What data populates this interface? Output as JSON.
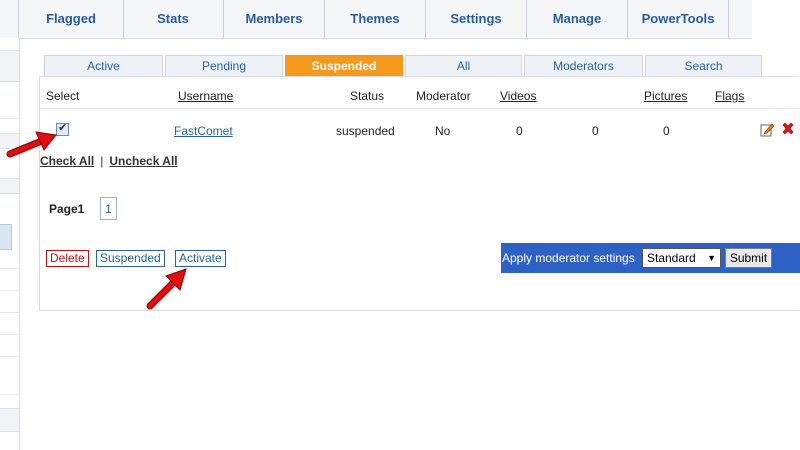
{
  "topnav": {
    "items": [
      "Flagged",
      "Stats",
      "Members",
      "Themes",
      "Settings",
      "Manage",
      "PowerTools"
    ]
  },
  "tabs": [
    {
      "label": "Active",
      "active": false
    },
    {
      "label": "Pending",
      "active": false
    },
    {
      "label": "Suspended",
      "active": true
    },
    {
      "label": "All",
      "active": false
    },
    {
      "label": "Moderators",
      "active": false
    },
    {
      "label": "Search",
      "active": false
    }
  ],
  "table": {
    "headers": {
      "select": "Select",
      "username": "Username",
      "status": "Status",
      "moderator": "Moderator",
      "videos": "Videos",
      "pictures": "Pictures",
      "flags": "Flags"
    },
    "rows": [
      {
        "checked": true,
        "username": "FastComet",
        "status": "suspended",
        "moderator": "No",
        "videos": "0",
        "col6": "0",
        "pictures": "0"
      }
    ]
  },
  "selection": {
    "check_all": "Check All",
    "separator": "|",
    "uncheck_all": "Uncheck All"
  },
  "pagination": {
    "label": "Page1",
    "pages": [
      "1"
    ]
  },
  "actions": {
    "delete": "Delete",
    "suspended": "Suspended",
    "activate": "Activate"
  },
  "moderator_settings": {
    "label": "Apply moderator settings",
    "selected": "Standard",
    "arrow": "▼",
    "submit": "Submit"
  },
  "colors": {
    "accent_tab": "#f39a1d",
    "mod_bar": "#2d62c4",
    "link": "#2a6496",
    "delete": "#b01818",
    "annotation_arrow": "#e01010"
  },
  "icons": [
    "edit-icon",
    "delete-icon",
    "checkbox-checked-icon",
    "annotation-arrow-icon"
  ]
}
